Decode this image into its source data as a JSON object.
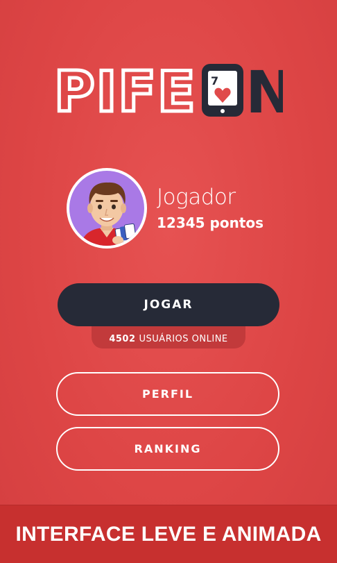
{
  "logo": {
    "text_left": "PIFE",
    "text_right": "N",
    "card_rank": "7"
  },
  "player": {
    "name": "Jogador",
    "points": "12345 pontos"
  },
  "actions": {
    "play_label": "JOGAR",
    "online_count": "4502",
    "online_label": "USUÁRIOS ONLINE",
    "profile_label": "PERFIL",
    "ranking_label": "RANKING"
  },
  "banner": {
    "text": "INTERFACE LEVE E ANIMADA"
  },
  "colors": {
    "background": "#e04a4a",
    "dark": "#262a37",
    "banner": "#c7302f",
    "avatar_bg": "#a979e6"
  }
}
